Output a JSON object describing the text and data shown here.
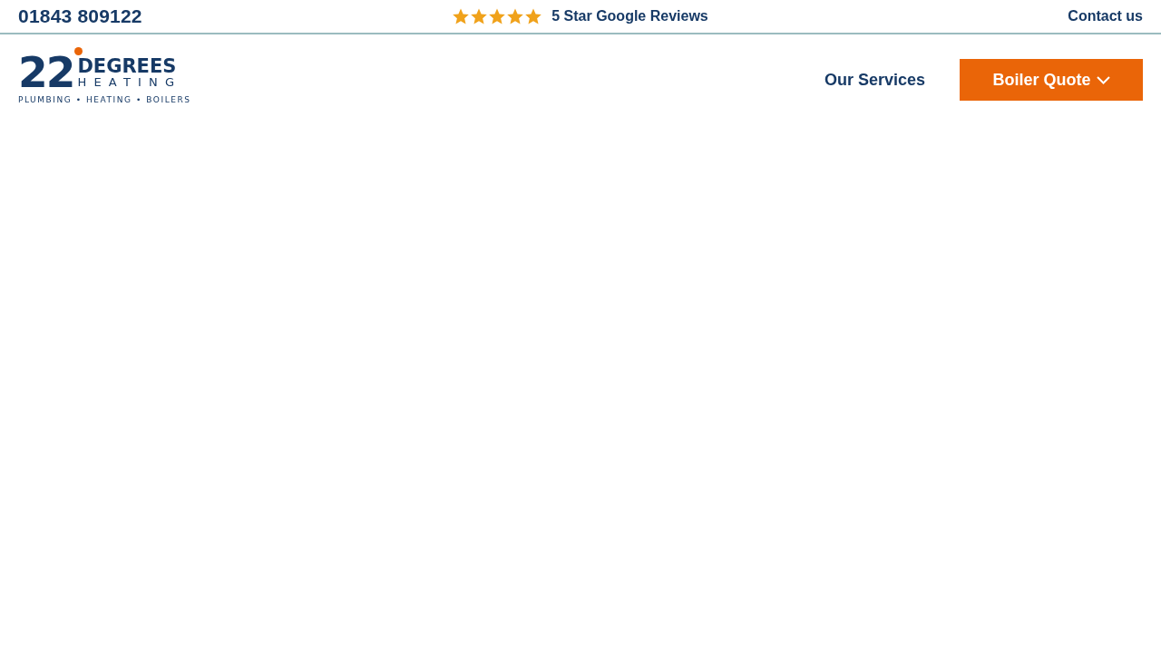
{
  "top_bar": {
    "phone": "01843 809122",
    "rating": {
      "stars": 5,
      "label": "5 Star Google Reviews"
    },
    "contact_link": "Contact us"
  },
  "header": {
    "logo": {
      "mark": "22",
      "name": "DEGREES",
      "subtitle": "HEATING",
      "tagline": "PLUMBING • HEATING • BOILERS"
    },
    "nav": [
      {
        "label": "Our Services",
        "kind": "link"
      },
      {
        "label": "Boiler Quote",
        "kind": "dropdown-button"
      }
    ]
  }
}
